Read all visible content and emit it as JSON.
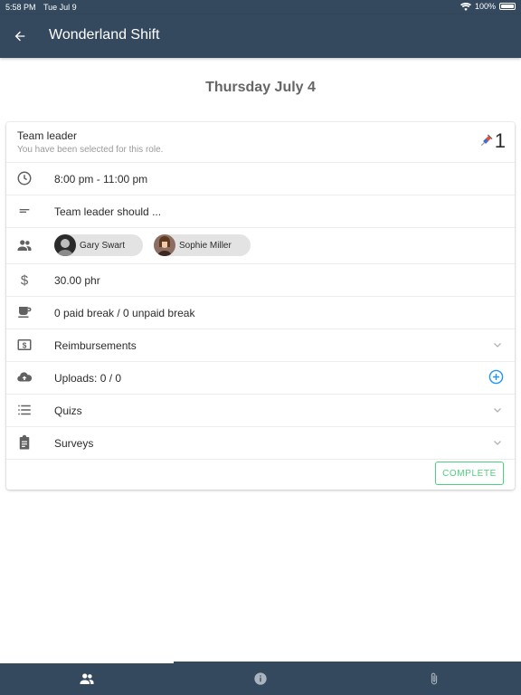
{
  "status_bar": {
    "time": "5:58 PM",
    "date": "Tue Jul 9",
    "battery": "100%"
  },
  "app_bar": {
    "title": "Wonderland Shift",
    "back_icon": "arrow-left-icon"
  },
  "date_heading": "Thursday July 4",
  "role": {
    "title": "Team leader",
    "subtitle": "You have been selected for this role.",
    "count": "1",
    "count_icon": "syringe-icon"
  },
  "details": {
    "time_range": "8:00 pm - 11:00 pm",
    "description": "Team leader should ...",
    "members": [
      {
        "name": "Gary Swart"
      },
      {
        "name": "Sophie Miller"
      }
    ],
    "pay": "30.00 phr",
    "breaks": "0 paid break / 0 unpaid break",
    "reimbursements": "Reimbursements",
    "uploads": "Uploads: 0 / 0",
    "quizzes": "Quizs",
    "surveys": "Surveys"
  },
  "complete_label": "COMPLETE",
  "tabs": [
    {
      "name": "people-icon",
      "active": true
    },
    {
      "name": "info-icon",
      "active": false
    },
    {
      "name": "paperclip-icon",
      "active": false
    }
  ],
  "colors": {
    "header": "#34495e",
    "accent": "#2196f3",
    "complete": "#4cd07d"
  }
}
